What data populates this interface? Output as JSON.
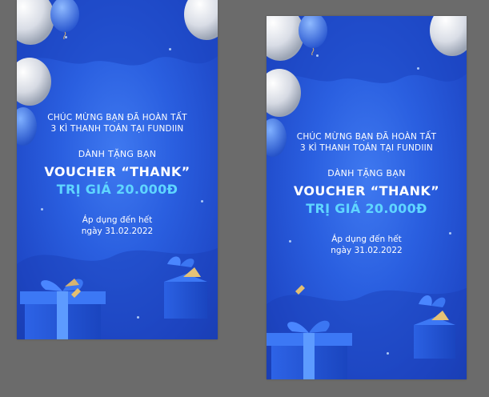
{
  "posters": [
    {
      "id": "left",
      "congrats_line1": "CHÚC MỪNG BẠN ĐÃ HOÀN TẤT",
      "congrats_line2": "3 KÌ THANH TOÁN TẠI FUNDIIN",
      "gift_lead": "DÀNH TẶNG BẠN",
      "voucher": "VOUCHER “THANK”",
      "value": "TRỊ GIÁ 20.000Đ",
      "apply_line1": "Áp dụng đến hết",
      "apply_line2": "ngày 31.02.2022"
    },
    {
      "id": "right",
      "congrats_line1": "CHÚC MỪNG BẠN ĐÃ HOÀN TẤT",
      "congrats_line2": "3 KÌ THANH TOÁN TẠI FUNDIIN",
      "gift_lead": "DÀNH TẶNG BẠN",
      "voucher": "VOUCHER “THANK”",
      "value": "TRỊ GIÁ 20.000Đ",
      "apply_line1": "Áp dụng đến hết",
      "apply_line2": "ngày 31.02.2022"
    }
  ],
  "colors": {
    "background": "#6b6b6b",
    "poster_blue": "#2a5fe0",
    "accent_cyan": "#5fd6ff",
    "text": "#ffffff"
  },
  "icons": {
    "balloon": "balloon-icon",
    "gift": "gift-box-icon",
    "confetti": "confetti-icon"
  }
}
